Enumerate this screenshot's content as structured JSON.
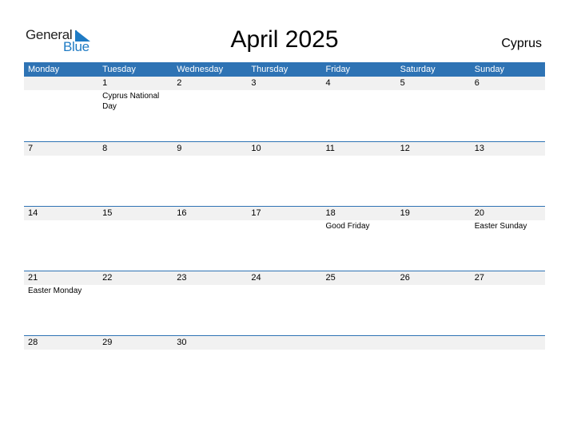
{
  "logo": {
    "general": "General",
    "blue": "Blue"
  },
  "title": "April 2025",
  "country": "Cyprus",
  "colors": {
    "header_bg": "#2e73b4",
    "date_row_bg": "#f1f1f1",
    "logo_blue": "#1f7bc4"
  },
  "weekdays": [
    "Monday",
    "Tuesday",
    "Wednesday",
    "Thursday",
    "Friday",
    "Saturday",
    "Sunday"
  ],
  "weeks": [
    {
      "dates": [
        "",
        "1",
        "2",
        "3",
        "4",
        "5",
        "6"
      ],
      "events": [
        "",
        "Cyprus National Day",
        "",
        "",
        "",
        "",
        ""
      ]
    },
    {
      "dates": [
        "7",
        "8",
        "9",
        "10",
        "11",
        "12",
        "13"
      ],
      "events": [
        "",
        "",
        "",
        "",
        "",
        "",
        ""
      ]
    },
    {
      "dates": [
        "14",
        "15",
        "16",
        "17",
        "18",
        "19",
        "20"
      ],
      "events": [
        "",
        "",
        "",
        "",
        "Good Friday",
        "",
        "Easter Sunday"
      ]
    },
    {
      "dates": [
        "21",
        "22",
        "23",
        "24",
        "25",
        "26",
        "27"
      ],
      "events": [
        "Easter Monday",
        "",
        "",
        "",
        "",
        "",
        ""
      ]
    },
    {
      "dates": [
        "28",
        "29",
        "30",
        "",
        "",
        "",
        ""
      ],
      "events": [
        "",
        "",
        "",
        "",
        "",
        "",
        ""
      ]
    }
  ]
}
